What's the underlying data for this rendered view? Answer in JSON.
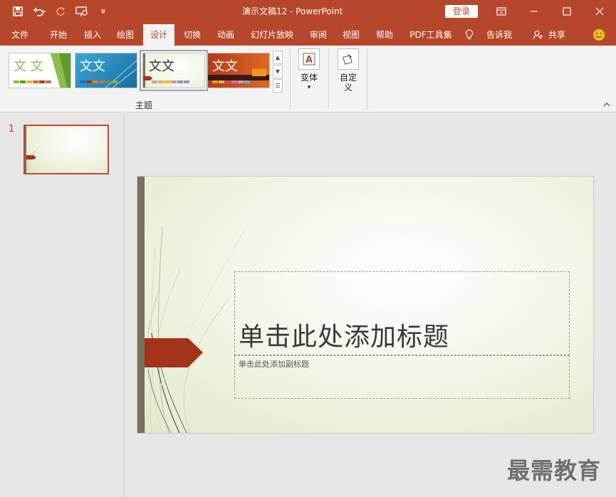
{
  "window": {
    "title": "演示文稿12  -  PowerPoint",
    "login": "登录",
    "controls": [
      "ribbon-options",
      "minimize",
      "maximize",
      "close"
    ]
  },
  "quick_access": {
    "icons": [
      "save-icon",
      "undo-icon",
      "redo-icon",
      "slideshow-from-start-icon",
      "customize-qat-icon"
    ]
  },
  "tabs": {
    "file": "文件",
    "home": "开始",
    "insert": "插入",
    "draw": "绘图",
    "design": "设计",
    "transitions": "切换",
    "animations": "动画",
    "slideshow": "幻灯片放映",
    "review": "审阅",
    "view": "视图",
    "help": "帮助",
    "pdf": "PDF工具集",
    "tell_me": "告诉我",
    "share": "共享",
    "active": "设计"
  },
  "ribbon": {
    "themes": {
      "group_label": "主题",
      "items": [
        {
          "text": "文 文",
          "selected": false
        },
        {
          "text": "文文",
          "selected": false
        },
        {
          "text": "文文",
          "selected": true
        },
        {
          "text": "文文",
          "selected": false
        }
      ]
    },
    "variants": {
      "label": "变体",
      "arrow": "▾"
    },
    "customize": {
      "label": "自定义",
      "arrow": "▾"
    }
  },
  "thumbnails": {
    "slides": [
      {
        "number": "1",
        "selected": true
      }
    ]
  },
  "slide": {
    "title_placeholder": "单击此处添加标题",
    "subtitle_placeholder": "单击此处添加副标题"
  },
  "watermark": "最需教育",
  "colors": {
    "accent": "#b7472a",
    "ribbon_bg": "#f3f3f3",
    "pane_bg": "#e6e6e6",
    "arrow_shape": "#a33319"
  }
}
